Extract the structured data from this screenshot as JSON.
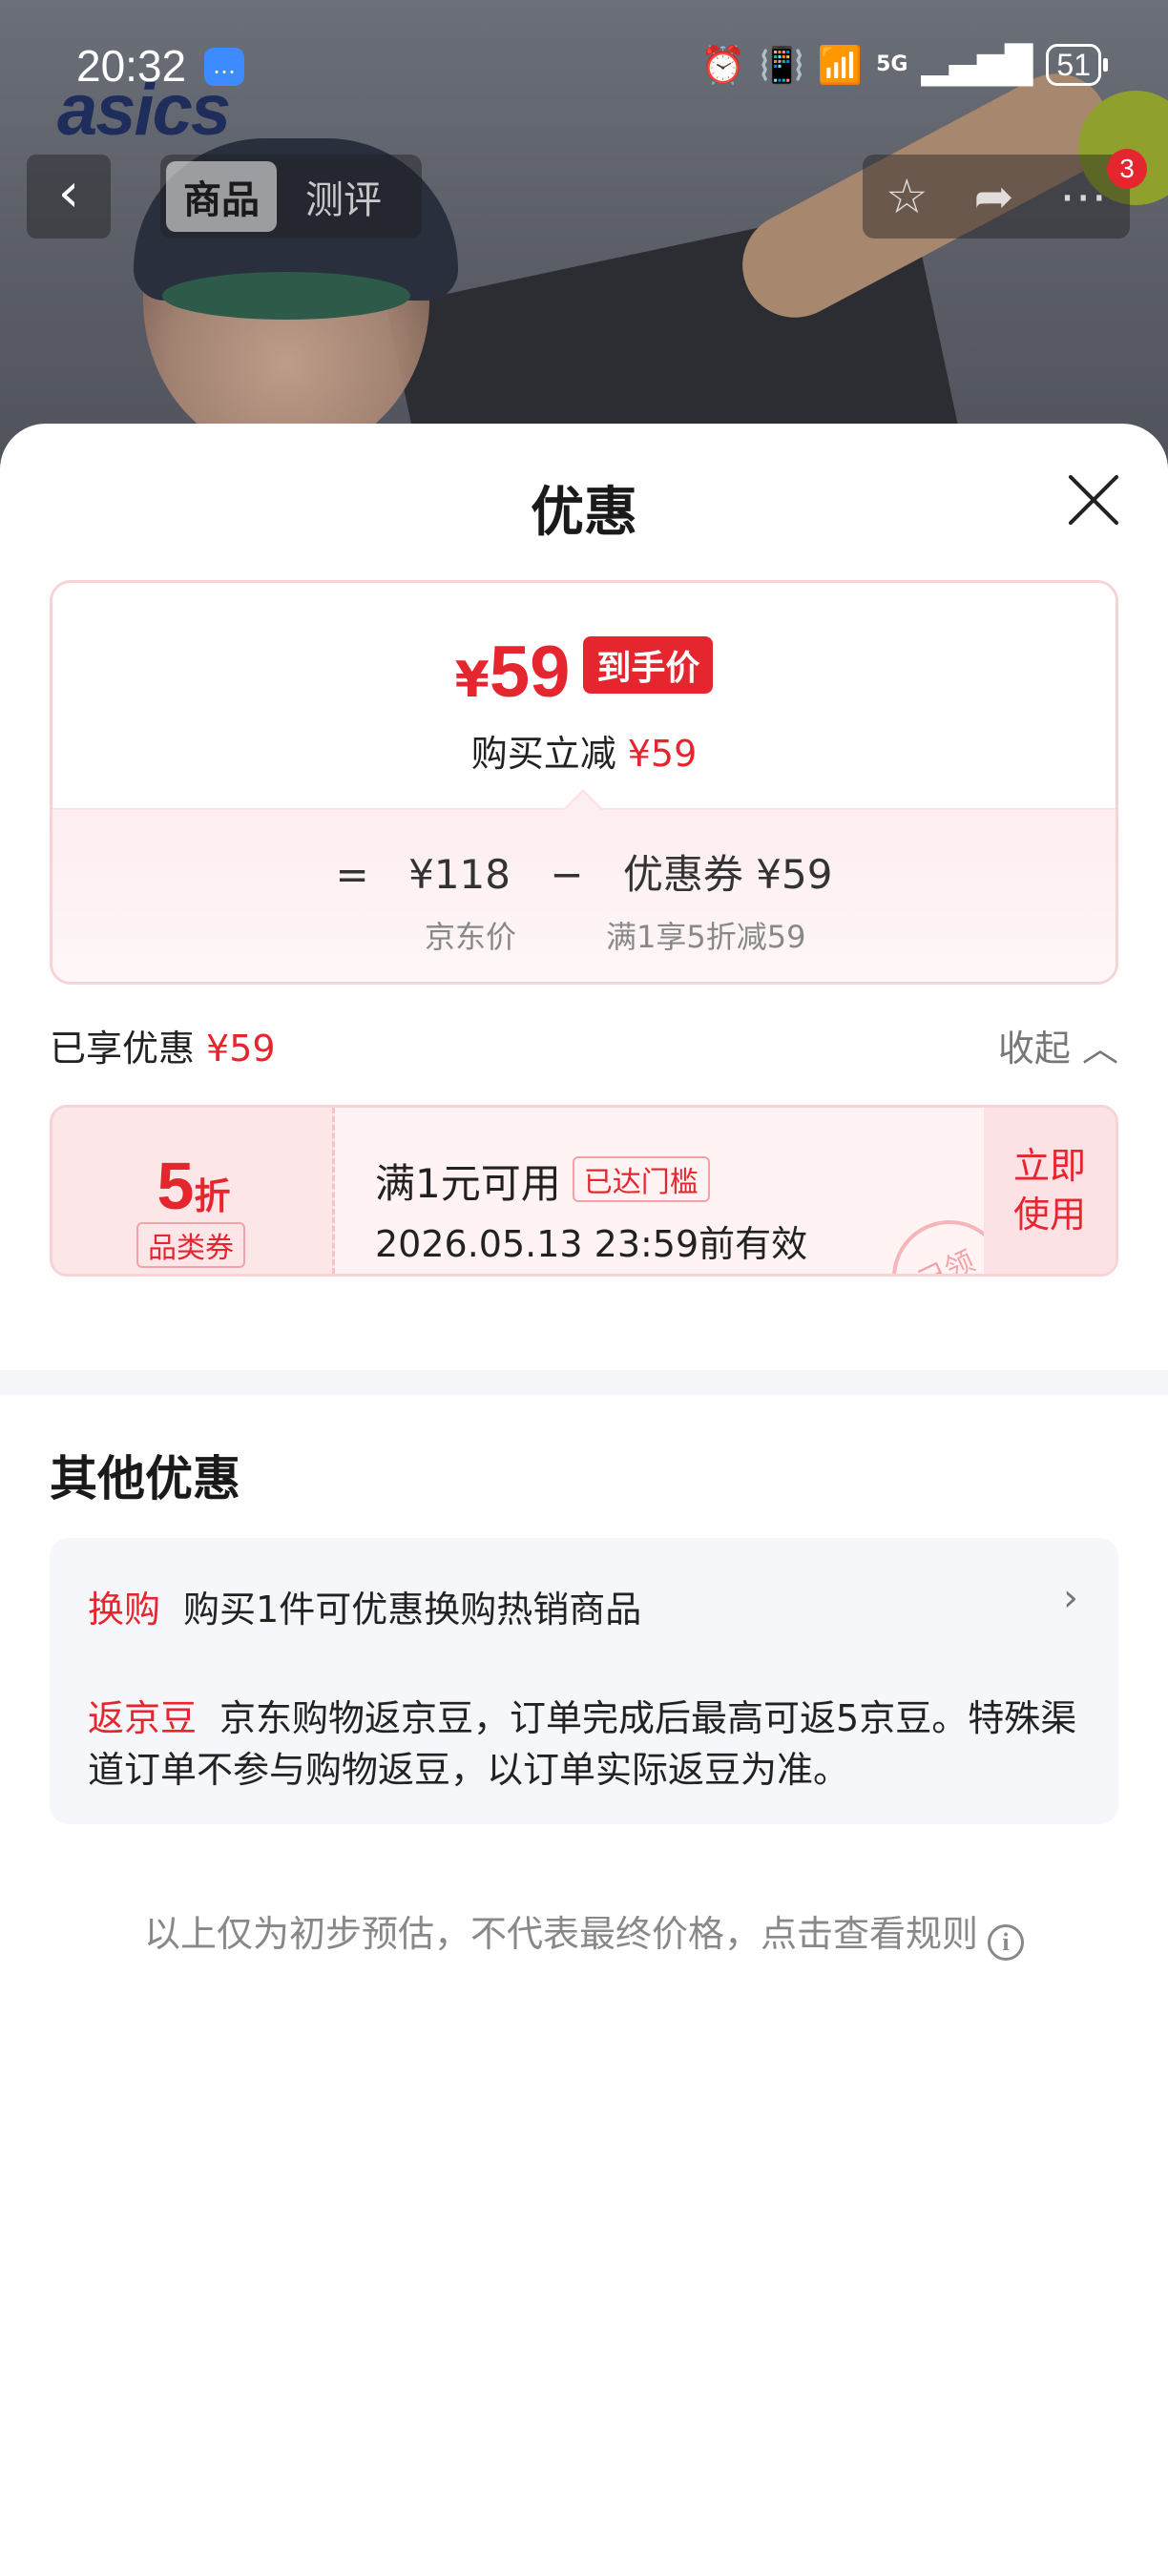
{
  "status_bar": {
    "time": "20:32",
    "battery": "51",
    "network": "5G"
  },
  "brand": {
    "logo_text": "asics"
  },
  "nav": {
    "back_symbol": "‹",
    "tabs": [
      {
        "label": "商品",
        "active": true
      },
      {
        "label": "测评",
        "active": false
      }
    ],
    "badge_count": "3"
  },
  "sheet": {
    "title": "优惠",
    "price_card": {
      "currency": "¥",
      "final_price": "59",
      "final_tag": "到手价",
      "sub_label": "购买立减",
      "sub_amount": "¥59",
      "formula": {
        "equals": "=",
        "jd_price": "¥118",
        "minus": "−",
        "coupon_label": "优惠券 ¥59"
      },
      "notes": {
        "jd_price_label": "京东价",
        "coupon_note": "满1享5折减59"
      }
    },
    "enjoyed": {
      "label": "已享优惠",
      "amount": "¥59",
      "collapse": "收起"
    },
    "coupon": {
      "value": "5",
      "unit": "折",
      "category": "品类券",
      "condition": "满1元可用",
      "condition_badge": "已达门槛",
      "expiry": "2026.05.13 23:59前有效",
      "action_line1": "立即",
      "action_line2": "使用",
      "stamp": "已领"
    },
    "other": {
      "title": "其他优惠",
      "items": [
        {
          "label": "换购",
          "text": "购买1件可优惠换购热销商品"
        },
        {
          "label": "返京豆",
          "text": "京东购物返京豆，订单完成后最高可返5京豆。特殊渠道订单不参与购物返豆，以订单实际返豆为准。"
        }
      ]
    },
    "disclaimer": "以上仅为初步预估，不代表最终价格，点击查看规则",
    "info_symbol": "i"
  },
  "colors": {
    "accent": "#e6262e",
    "card_border": "#f7d3d6"
  }
}
